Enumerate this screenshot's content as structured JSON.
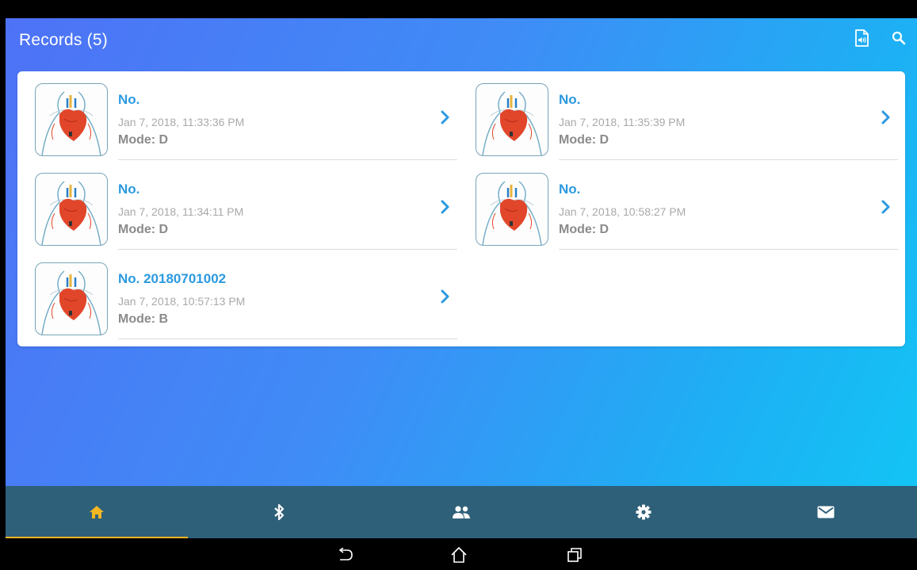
{
  "header": {
    "title": "Records (5)",
    "icons": [
      "audio-file-icon",
      "search-icon"
    ]
  },
  "records": [
    {
      "number": "No.",
      "datetime": "Jan 7, 2018, 11:33:36 PM",
      "mode": "Mode: D"
    },
    {
      "number": "No.",
      "datetime": "Jan 7, 2018, 11:35:39 PM",
      "mode": "Mode: D"
    },
    {
      "number": "No.",
      "datetime": "Jan 7, 2018, 11:34:11 PM",
      "mode": "Mode: D"
    },
    {
      "number": "No.",
      "datetime": "Jan 7, 2018, 10:58:27 PM",
      "mode": "Mode: D"
    },
    {
      "number": "No. 20180701002",
      "datetime": "Jan 7, 2018, 10:57:13 PM",
      "mode": "Mode: B"
    }
  ],
  "bottom_nav": {
    "tabs": [
      "home-icon",
      "bluetooth-icon",
      "users-icon",
      "settings-icon",
      "mail-icon"
    ],
    "active_tab": "home-icon",
    "active_color": "#f4b623"
  },
  "system_nav": [
    "back-icon",
    "home-outline-icon",
    "recents-icon"
  ],
  "colors": {
    "accent": "#2b9ae0",
    "gradient_start": "#4e72f6",
    "gradient_end": "#13c4f5",
    "nav_bar": "#2f6079"
  }
}
